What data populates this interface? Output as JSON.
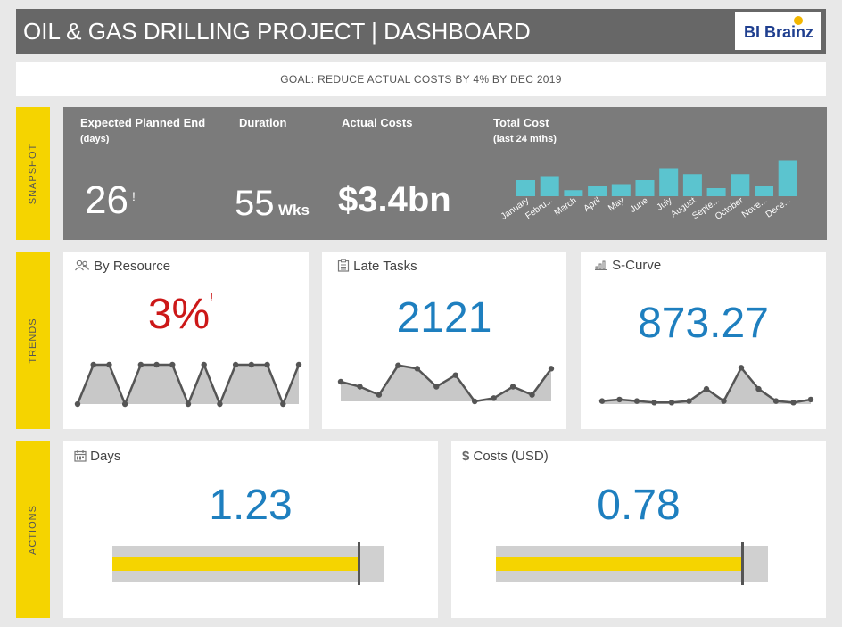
{
  "header": {
    "title_light": "OIL & GAS DRILLING PROJECT | ",
    "title_bold": "DASHBOARD",
    "logo_text": "BI Brainz"
  },
  "goal": {
    "text": "GOAL: REDUCE ACTUAL COSTS BY 4% BY DEC 2019"
  },
  "side_labels": {
    "snapshot": "SNAPSHOT",
    "trends": "TRENDS",
    "actions": "ACTIONS"
  },
  "snapshot": {
    "planned_end": {
      "label": "Expected Planned End",
      "sub": "(days)",
      "value": "26",
      "flag": "!"
    },
    "duration": {
      "label": "Duration",
      "value": "55",
      "unit": "Wks"
    },
    "actual_costs": {
      "label": "Actual Costs",
      "value": "$3.4bn"
    },
    "total_cost": {
      "label": "Total Cost",
      "sub": "(last 24 mths)"
    }
  },
  "chart_data": [
    {
      "type": "bar",
      "title": "Total Cost",
      "subtitle": "(last 24 mths)",
      "categories": [
        "January",
        "Febru...",
        "March",
        "April",
        "May",
        "June",
        "July",
        "August",
        "Septe...",
        "October",
        "Nove...",
        "Dece..."
      ],
      "values": [
        4,
        5,
        1.5,
        2.5,
        3,
        4,
        7,
        5.5,
        2,
        5.5,
        2.5,
        9
      ],
      "ylim": [
        0,
        10
      ],
      "color": "#5bc4cf"
    },
    {
      "type": "area",
      "title": "By Resource",
      "values": [
        0,
        10,
        10,
        0,
        10,
        10,
        10,
        0,
        10,
        0,
        10,
        10,
        10,
        0,
        10
      ],
      "ylim": [
        0,
        10
      ],
      "color": "#c8c8c8",
      "line_color": "#555555"
    },
    {
      "type": "area",
      "title": "Late Tasks",
      "values": [
        6,
        4.5,
        2,
        11,
        10,
        4.5,
        8,
        0,
        1,
        4.5,
        2,
        10
      ],
      "ylim": [
        0,
        12
      ],
      "color": "#c8c8c8",
      "line_color": "#555555"
    },
    {
      "type": "area",
      "title": "S-Curve",
      "values": [
        0,
        0.5,
        0,
        -0.5,
        -0.5,
        0,
        4,
        0,
        11,
        4,
        0,
        -0.5,
        0.5
      ],
      "ylim": [
        -1,
        12
      ],
      "color": "#c8c8c8",
      "line_color": "#555555"
    },
    {
      "type": "bar",
      "title": "Days",
      "value": 1.23,
      "fill_fraction": 0.9,
      "target_fraction": 0.9
    },
    {
      "type": "bar",
      "title": "Costs (USD)",
      "value": 0.78,
      "fill_fraction": 0.91,
      "target_fraction": 0.9
    }
  ],
  "trends": {
    "resource": {
      "title": "By Resource",
      "icon": "people-icon",
      "value": "3%",
      "flag": "!"
    },
    "late_tasks": {
      "title": "Late Tasks",
      "icon": "clipboard-icon",
      "value": "2121"
    },
    "s_curve": {
      "title": "S-Curve",
      "icon": "bar-signal-icon",
      "value": "873.27"
    }
  },
  "actions": {
    "days": {
      "title": "Days",
      "icon": "calendar-icon",
      "value": "1.23"
    },
    "costs": {
      "title": "Costs (USD)",
      "icon": "dollar-icon",
      "icon_glyph": "$",
      "value": "0.78"
    }
  },
  "colors": {
    "accent_yellow": "#f5d400",
    "kpi_blue": "#1e7fbf",
    "alert_red": "#cc1818",
    "bar_teal": "#5bc4cf"
  }
}
